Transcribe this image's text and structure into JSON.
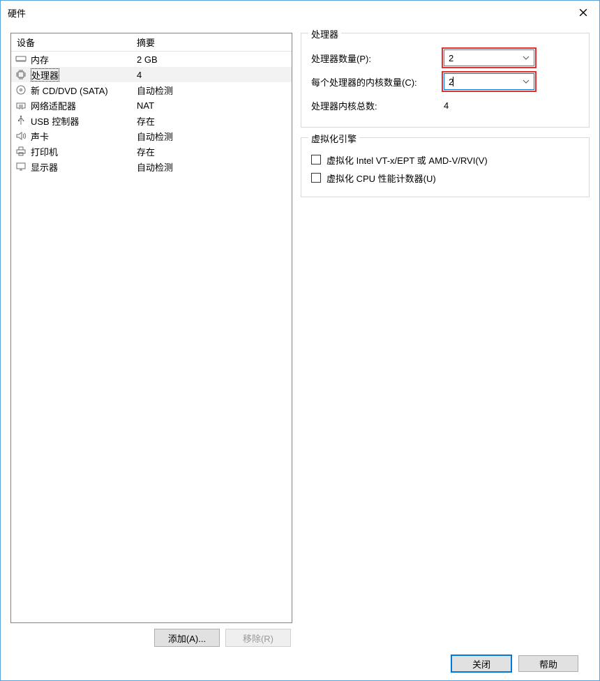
{
  "window": {
    "title": "硬件"
  },
  "deviceList": {
    "headers": {
      "device": "设备",
      "summary": "摘要"
    },
    "rows": [
      {
        "icon": "memory",
        "name": "内存",
        "summary": "2 GB",
        "selected": false
      },
      {
        "icon": "cpu",
        "name": "处理器",
        "summary": "4",
        "selected": true
      },
      {
        "icon": "disc",
        "name": "新 CD/DVD (SATA)",
        "summary": "自动检测",
        "selected": false
      },
      {
        "icon": "network",
        "name": "网络适配器",
        "summary": "NAT",
        "selected": false
      },
      {
        "icon": "usb",
        "name": "USB 控制器",
        "summary": "存在",
        "selected": false
      },
      {
        "icon": "sound",
        "name": "声卡",
        "summary": "自动检测",
        "selected": false
      },
      {
        "icon": "printer",
        "name": "打印机",
        "summary": "存在",
        "selected": false
      },
      {
        "icon": "display",
        "name": "显示器",
        "summary": "自动检测",
        "selected": false
      }
    ]
  },
  "buttons": {
    "add": "添加(A)...",
    "remove": "移除(R)",
    "close": "关闭",
    "help": "帮助"
  },
  "processorGroup": {
    "legend": "处理器",
    "numProcessorsLabel": "处理器数量(P):",
    "numProcessorsValue": "2",
    "coresPerLabel": "每个处理器的内核数量(C):",
    "coresPerValue": "2",
    "totalCoresLabel": "处理器内核总数:",
    "totalCoresValue": "4"
  },
  "virtGroup": {
    "legend": "虚拟化引擎",
    "vtx": "虚拟化 Intel VT-x/EPT 或 AMD-V/RVI(V)",
    "perfCounters": "虚拟化 CPU 性能计数器(U)"
  }
}
